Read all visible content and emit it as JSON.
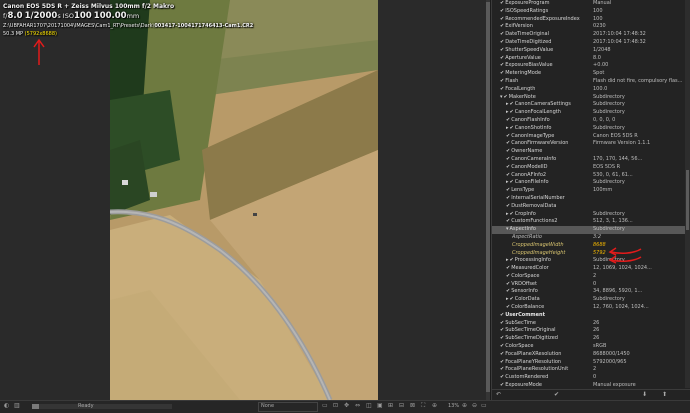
{
  "overlay": {
    "camera_lens": "Canon EOS 5DS R + Zeiss Milvus 100mm f/2 Makro",
    "aperture": "8.0",
    "shutter": "1/2000",
    "shutter_unit": "s",
    "iso_label": "ISO",
    "iso": "100",
    "focal": "100.00",
    "focal_unit": "mm",
    "path_prefix": "Z:\\UBFAHAR1707\\20171004\\IMAGES\\Cam1_RT\\Presets\\Dark\\",
    "filename": "003417-1004171746413-Cam1.CR2",
    "megapixels": "50.3 MP",
    "dimensions": "(5792x8688)",
    "colors": {
      "dimensions": "#ffe600",
      "arrow": "#e31b1b"
    }
  },
  "statusbar": {
    "ready": "Ready",
    "dropdown_value": "None",
    "zoom": "13%"
  },
  "metadata_rows": [
    {
      "key": "ExposureProgram",
      "value": "Manual",
      "indent": 1,
      "check": true
    },
    {
      "key": "ISOSpeedRatings",
      "value": "100",
      "indent": 1,
      "check": true
    },
    {
      "key": "RecommendedExposureIndex",
      "value": "100",
      "indent": 1,
      "check": true
    },
    {
      "key": "ExifVersion",
      "value": "0230",
      "indent": 1,
      "check": true
    },
    {
      "key": "DateTimeOriginal",
      "value": "2017:10:04 17:48:32",
      "indent": 1,
      "check": true
    },
    {
      "key": "DateTimeDigitized",
      "value": "2017:10:04 17:48:32",
      "indent": 1,
      "check": true
    },
    {
      "key": "ShutterSpeedValue",
      "value": "1/2048",
      "indent": 1,
      "check": true
    },
    {
      "key": "ApertureValue",
      "value": "8.0",
      "indent": 1,
      "check": true
    },
    {
      "key": "ExposureBiasValue",
      "value": "+0.00",
      "indent": 1,
      "check": true
    },
    {
      "key": "MeteringMode",
      "value": "Spot",
      "indent": 1,
      "check": true
    },
    {
      "key": "Flash",
      "value": "Flash did not fire, compulsory flas...",
      "indent": 1,
      "check": true
    },
    {
      "key": "FocalLength",
      "value": "100.0",
      "indent": 1,
      "check": true
    },
    {
      "key": "MakerNote",
      "value": "Subdirectory",
      "indent": 1,
      "check": true,
      "expander": "▾"
    },
    {
      "key": "CanonCameraSettings",
      "value": "Subdirectory",
      "indent": 2,
      "check": true,
      "expander": "▸"
    },
    {
      "key": "CanonFocalLength",
      "value": "Subdirectory",
      "indent": 2,
      "check": true,
      "expander": "▸"
    },
    {
      "key": "CanonFlashInfo",
      "value": "0, 0, 0, 0",
      "indent": 2,
      "check": true
    },
    {
      "key": "CanonShotInfo",
      "value": "Subdirectory",
      "indent": 2,
      "check": true,
      "expander": "▸"
    },
    {
      "key": "CanonImageType",
      "value": "Canon EOS 5DS R",
      "indent": 2,
      "check": true
    },
    {
      "key": "CanonFirmwareVersion",
      "value": "Firmware Version 1.1.1",
      "indent": 2,
      "check": true
    },
    {
      "key": "OwnerName",
      "value": "",
      "indent": 2,
      "check": true
    },
    {
      "key": "CanonCameraInfo",
      "value": "170, 170, 144, 56...",
      "indent": 2,
      "check": true
    },
    {
      "key": "CanonModelID",
      "value": "EOS 5DS R",
      "indent": 2,
      "check": true
    },
    {
      "key": "CanonAFInfo2",
      "value": "530, 0, 61, 61...",
      "indent": 2,
      "check": true
    },
    {
      "key": "CanonFileInfo",
      "value": "Subdirectory",
      "indent": 2,
      "check": true,
      "expander": "▸"
    },
    {
      "key": "LensType",
      "value": "100mm",
      "indent": 2,
      "check": true
    },
    {
      "key": "InternalSerialNumber",
      "value": "",
      "indent": 2,
      "check": true
    },
    {
      "key": "DustRemovalData",
      "value": "",
      "indent": 2,
      "check": true
    },
    {
      "key": "CropInfo",
      "value": "Subdirectory",
      "indent": 2,
      "check": true,
      "expander": "▸"
    },
    {
      "key": "CustomFunctions2",
      "value": "512, 3, 1, 136...",
      "indent": 2,
      "check": true
    },
    {
      "key": "AspectInfo",
      "value": "Subdirectory",
      "indent": 2,
      "check": false,
      "expander": "▾",
      "selected": true
    },
    {
      "key": "AspectRatio",
      "value": "3:2",
      "indent": 3,
      "check": false,
      "italic": true
    },
    {
      "key": "CroppedImageWidth",
      "value": "8688",
      "indent": 3,
      "check": false,
      "highlight": true
    },
    {
      "key": "CroppedImageHeight",
      "value": "5792",
      "indent": 3,
      "check": false,
      "highlight": true
    },
    {
      "key": "ProcessingInfo",
      "value": "Subdirectory",
      "indent": 2,
      "check": true,
      "expander": "▸"
    },
    {
      "key": "MeasuredColor",
      "value": "12, 1069, 1024, 1024...",
      "indent": 2,
      "check": true
    },
    {
      "key": "ColorSpace",
      "value": "2",
      "indent": 2,
      "check": true
    },
    {
      "key": "VRDOffset",
      "value": "0",
      "indent": 2,
      "check": true
    },
    {
      "key": "SensorInfo",
      "value": "34, 8896, 5920, 1...",
      "indent": 2,
      "check": true
    },
    {
      "key": "ColorData",
      "value": "Subdirectory",
      "indent": 2,
      "check": true,
      "expander": "▸"
    },
    {
      "key": "ColorBalance",
      "value": "12, 760, 1024, 1024...",
      "indent": 2,
      "check": true
    },
    {
      "key": "UserComment",
      "value": "",
      "indent": 1,
      "check": true,
      "bold": true
    },
    {
      "key": "SubSecTime",
      "value": "26",
      "indent": 1,
      "check": true
    },
    {
      "key": "SubSecTimeOriginal",
      "value": "26",
      "indent": 1,
      "check": true
    },
    {
      "key": "SubSecTimeDigitized",
      "value": "26",
      "indent": 1,
      "check": true
    },
    {
      "key": "ColorSpace",
      "value": "sRGB",
      "indent": 1,
      "check": true
    },
    {
      "key": "FocalPlaneXResolution",
      "value": "8688000/1450",
      "indent": 1,
      "check": true
    },
    {
      "key": "FocalPlaneYResolution",
      "value": "5792000/965",
      "indent": 1,
      "check": true
    },
    {
      "key": "FocalPlaneResolutionUnit",
      "value": "2",
      "indent": 1,
      "check": true
    },
    {
      "key": "CustomRendered",
      "value": "0",
      "indent": 1,
      "check": true
    },
    {
      "key": "ExposureMode",
      "value": "Manual exposure",
      "indent": 1,
      "check": true
    },
    {
      "key": "WhiteBalance",
      "value": "Manual white balance",
      "indent": 1,
      "check": true
    }
  ],
  "icons": {
    "status_left": [
      "◐",
      "▥"
    ],
    "status_tools": [
      "▭",
      "⊡",
      "✥",
      "⇔",
      "◫",
      "▣",
      "⊞",
      "⊟",
      "⊠",
      "⛶",
      "⊕"
    ],
    "zoom_controls": [
      "⊕",
      "⊖",
      "▭"
    ],
    "panel_foot": [
      "↶",
      "✔",
      "⬇",
      "⬆"
    ]
  }
}
